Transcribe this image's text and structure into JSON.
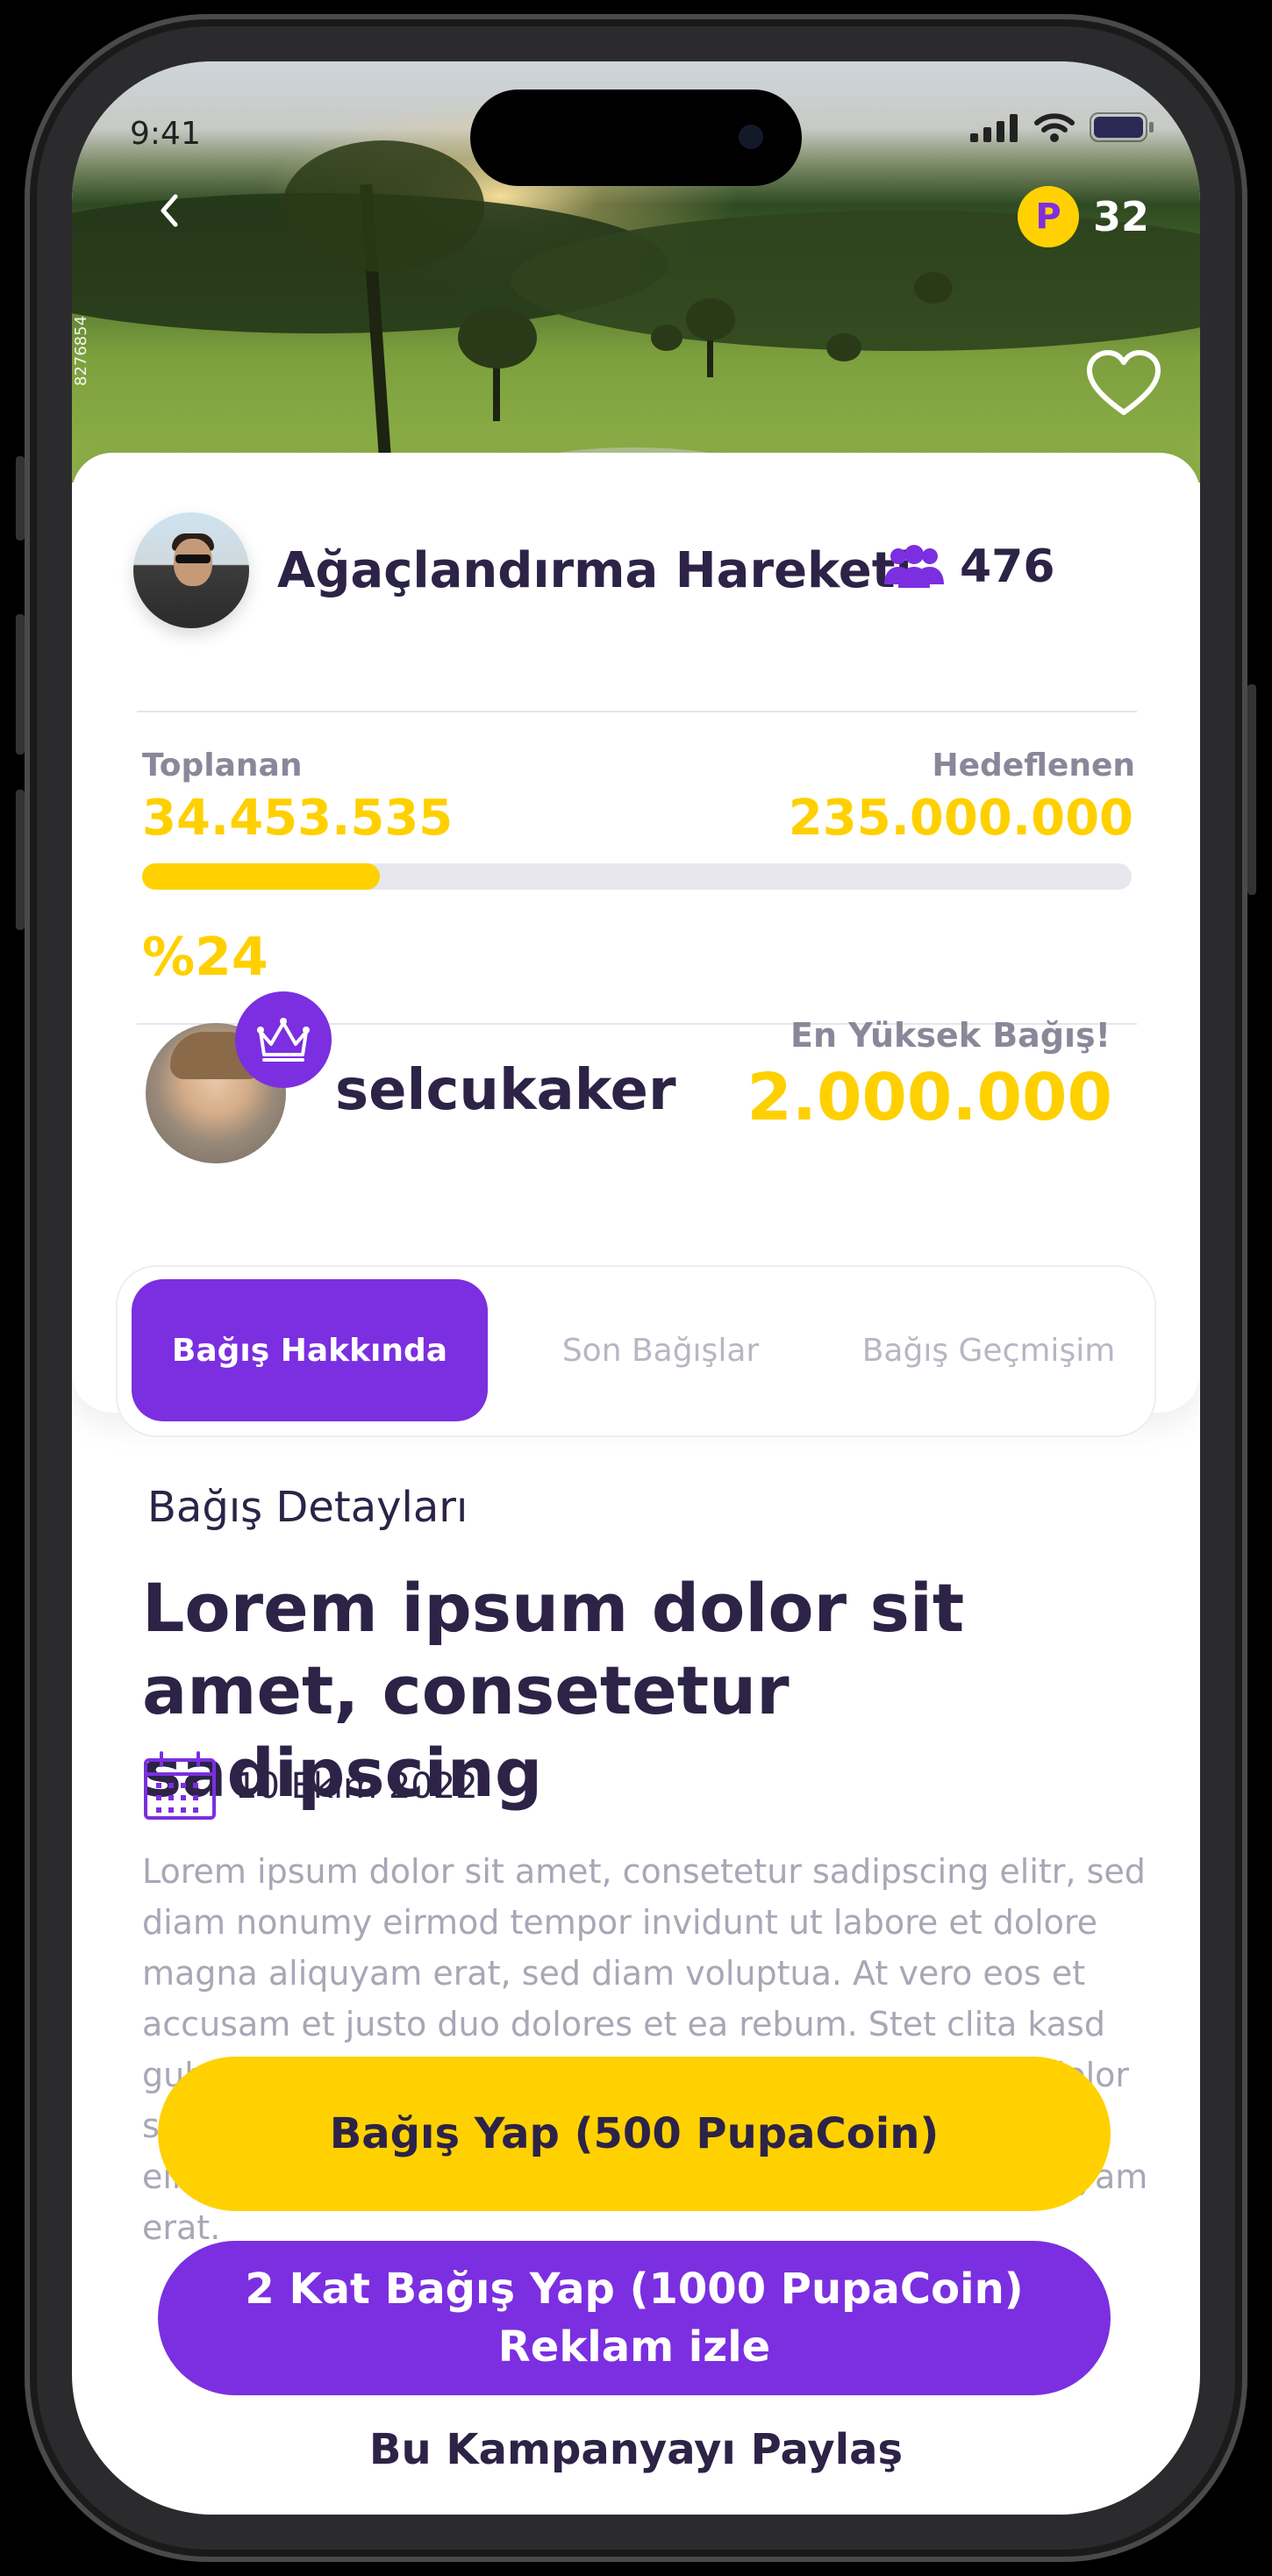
{
  "status_bar": {
    "time": "9:41"
  },
  "header": {
    "coin_count": "32",
    "coin_symbol": "P",
    "photo_credit": "8276854"
  },
  "campaign": {
    "name": "Ağaçlandırma Hareketi",
    "members": "476",
    "collected_label": "Toplanan",
    "collected_value": "34.453.535",
    "target_label": "Hedeflenen",
    "target_value": "235.000.000",
    "progress_percent": 24,
    "progress_text": "%24"
  },
  "top_donor": {
    "username": "selcukaker",
    "label": "En Yüksek Bağış!",
    "amount": "2.000.000"
  },
  "tabs": [
    {
      "label": "Bağış Hakkında",
      "active": true
    },
    {
      "label": "Son Bağışlar",
      "active": false
    },
    {
      "label": "Bağış Geçmişim",
      "active": false
    }
  ],
  "details": {
    "section_title": "Bağış Detayları",
    "headline": "Lorem ipsum dolor sit amet, consetetur sadipscing",
    "date": "10 Ekim 2022",
    "body": "Lorem ipsum dolor sit amet, consetetur sadipscing elitr, sed diam nonumy eirmod tempor invidunt ut labore et dolore magna aliquyam erat, sed diam voluptua. At vero eos et accusam et justo duo dolores et ea rebum. Stet clita kasd gubergren, no sea takimata sanctus est Lorem ipsum dolor sit amet. Consetetur sadipscing elitr, sed diam nonumy eirmod tempor invidunt ut labore et dolore magna aliquyam erat."
  },
  "actions": {
    "donate_label": "Bağış Yap (500 PupaCoin)",
    "double_line1": "2 Kat Bağış Yap (1000 PupaCoin)",
    "double_line2": "Reklam izle",
    "share_label": "Bu Kampanyayı Paylaş"
  },
  "colors": {
    "accent_purple": "#7b2fe0",
    "accent_yellow": "#ffd100",
    "text_dark": "#2c2347"
  }
}
